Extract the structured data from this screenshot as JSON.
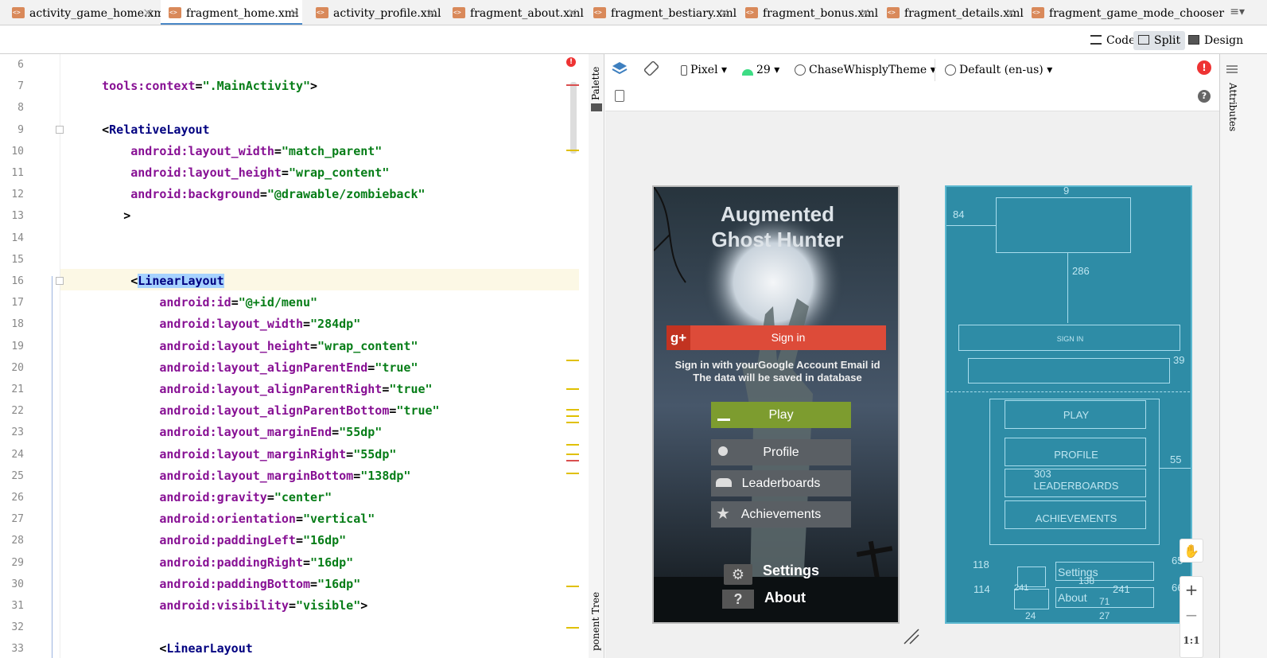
{
  "tabs": [
    {
      "label": "activity_game_home.xml"
    },
    {
      "label": "fragment_home.xml",
      "selected": true
    },
    {
      "label": "activity_profile.xml"
    },
    {
      "label": "fragment_about.xml"
    },
    {
      "label": "fragment_bestiary.xml"
    },
    {
      "label": "fragment_bonus.xml"
    },
    {
      "label": "fragment_details.xml"
    },
    {
      "label": "fragment_game_mode_chooser"
    }
  ],
  "view_modes": {
    "code": "Code",
    "split": "Split",
    "design": "Design"
  },
  "editor": {
    "lines": [
      {
        "n": "6",
        "parts": []
      },
      {
        "n": "7",
        "parts": [
          [
            "attr",
            "    tools:context"
          ],
          [
            "pl",
            "="
          ],
          [
            "val",
            "\".MainActivity\""
          ],
          [
            "pl",
            ">"
          ]
        ]
      },
      {
        "n": "8",
        "parts": []
      },
      {
        "n": "9",
        "parts": [
          [
            "pl",
            "    <"
          ],
          [
            "tag",
            "RelativeLayout"
          ]
        ]
      },
      {
        "n": "10",
        "parts": [
          [
            "attr",
            "        android:layout_width"
          ],
          [
            "pl",
            "="
          ],
          [
            "val",
            "\"match_parent\""
          ]
        ]
      },
      {
        "n": "11",
        "parts": [
          [
            "attr",
            "        android:layout_height"
          ],
          [
            "pl",
            "="
          ],
          [
            "val",
            "\"wrap_content\""
          ]
        ]
      },
      {
        "n": "12",
        "parts": [
          [
            "attr",
            "        android:background"
          ],
          [
            "pl",
            "="
          ],
          [
            "val",
            "\"@drawable/zombieback\""
          ]
        ]
      },
      {
        "n": "13",
        "parts": [
          [
            "pl",
            "       >"
          ]
        ]
      },
      {
        "n": "14",
        "parts": []
      },
      {
        "n": "15",
        "parts": []
      },
      {
        "n": "16",
        "parts": [
          [
            "pl",
            "        <"
          ],
          [
            "tag",
            "LinearLayout"
          ]
        ]
      },
      {
        "n": "17",
        "parts": [
          [
            "attr",
            "            android:id"
          ],
          [
            "pl",
            "="
          ],
          [
            "val",
            "\"@+id/menu\""
          ]
        ]
      },
      {
        "n": "18",
        "parts": [
          [
            "attr",
            "            android:layout_width"
          ],
          [
            "pl",
            "="
          ],
          [
            "val",
            "\"284dp\""
          ]
        ]
      },
      {
        "n": "19",
        "parts": [
          [
            "attr",
            "            android:layout_height"
          ],
          [
            "pl",
            "="
          ],
          [
            "val",
            "\"wrap_content\""
          ]
        ]
      },
      {
        "n": "20",
        "parts": [
          [
            "attr",
            "            android:layout_alignParentEnd"
          ],
          [
            "pl",
            "="
          ],
          [
            "val",
            "\"true\""
          ]
        ]
      },
      {
        "n": "21",
        "parts": [
          [
            "attr",
            "            android:layout_alignParentRight"
          ],
          [
            "pl",
            "="
          ],
          [
            "val",
            "\"true\""
          ]
        ]
      },
      {
        "n": "22",
        "parts": [
          [
            "attr",
            "            android:layout_alignParentBottom"
          ],
          [
            "pl",
            "="
          ],
          [
            "val",
            "\"true\""
          ]
        ]
      },
      {
        "n": "23",
        "parts": [
          [
            "attr",
            "            android:layout_marginEnd"
          ],
          [
            "pl",
            "="
          ],
          [
            "val",
            "\"55dp\""
          ]
        ]
      },
      {
        "n": "24",
        "parts": [
          [
            "attr",
            "            android:layout_marginRight"
          ],
          [
            "pl",
            "="
          ],
          [
            "val",
            "\"55dp\""
          ]
        ]
      },
      {
        "n": "25",
        "parts": [
          [
            "attr",
            "            android:layout_marginBottom"
          ],
          [
            "pl",
            "="
          ],
          [
            "val",
            "\"138dp\""
          ]
        ]
      },
      {
        "n": "26",
        "parts": [
          [
            "attr",
            "            android:gravity"
          ],
          [
            "pl",
            "="
          ],
          [
            "val",
            "\"center\""
          ]
        ]
      },
      {
        "n": "27",
        "parts": [
          [
            "attr",
            "            android:orientation"
          ],
          [
            "pl",
            "="
          ],
          [
            "val",
            "\"vertical\""
          ]
        ]
      },
      {
        "n": "28",
        "parts": [
          [
            "attr",
            "            android:paddingLeft"
          ],
          [
            "pl",
            "="
          ],
          [
            "val",
            "\"16dp\""
          ]
        ]
      },
      {
        "n": "29",
        "parts": [
          [
            "attr",
            "            android:paddingRight"
          ],
          [
            "pl",
            "="
          ],
          [
            "val",
            "\"16dp\""
          ]
        ]
      },
      {
        "n": "30",
        "parts": [
          [
            "attr",
            "            android:paddingBottom"
          ],
          [
            "pl",
            "="
          ],
          [
            "val",
            "\"16dp\""
          ]
        ]
      },
      {
        "n": "31",
        "parts": [
          [
            "attr",
            "            android:visibility"
          ],
          [
            "pl",
            "="
          ],
          [
            "val",
            "\"visible\""
          ],
          [
            "pl",
            ">"
          ]
        ]
      },
      {
        "n": "32",
        "parts": []
      },
      {
        "n": "33",
        "parts": [
          [
            "pl",
            "            <"
          ],
          [
            "tag",
            "LinearLayout"
          ]
        ]
      }
    ]
  },
  "design_toolbar": {
    "device": "Pixel",
    "api": "29",
    "theme": "ChaseWhisplyTheme",
    "locale": "Default (en-us)"
  },
  "side_labels": {
    "palette": "Palette",
    "component_tree": "ponent Tree",
    "attributes": "Attributes"
  },
  "phone": {
    "title_line1": "Augmented",
    "title_line2": "Ghost Hunter",
    "signin": "Sign in",
    "signin_note1": "Sign in with yourGoogle Account Email id",
    "signin_note2": "The data will be saved in database",
    "play": "Play",
    "profile": "Profile",
    "leaderboards": "Leaderboards",
    "achievements": "Achievements",
    "settings": "Settings",
    "about": "About"
  },
  "blueprint": {
    "m84": "84",
    "m286": "286",
    "signin": "SIGN IN",
    "m39": "39",
    "play": "PLAY",
    "profile": "PROFILE",
    "m303": "303",
    "leaderboards": "LEADERBOARDS",
    "achievements": "ACHIEVEMENTS",
    "m55": "55",
    "m118": "118",
    "m114": "114",
    "settings": "Settings",
    "about": "About",
    "m138": "138",
    "m241a": "241",
    "m241b": "241",
    "m71": "71",
    "m24": "24",
    "m27": "27",
    "m65": "65",
    "m66": "66",
    "m9": "9"
  },
  "zoom": {
    "plus": "+",
    "minus": "−",
    "fit": "1:1"
  }
}
